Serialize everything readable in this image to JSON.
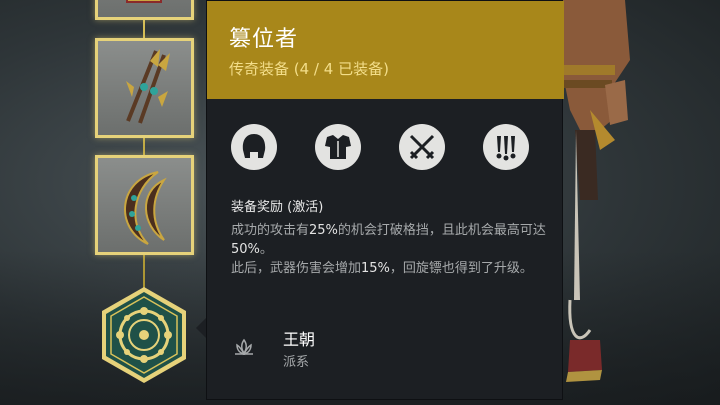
{
  "tooltip": {
    "title": "篡位者",
    "subtitle": "传奇装备 (4 / 4 已装备)",
    "icons": [
      "helmet-icon",
      "chest-armor-icon",
      "crossed-swords-icon",
      "throwing-knives-icon"
    ],
    "bonus_title": "装备奖励 (激活)",
    "bonus_desc": {
      "p1_a": "成功的攻击有",
      "p1_b": "25%",
      "p1_c": "的机会打破格挡，且此机会最高可达",
      "p1_d": "50%",
      "p1_e": "。",
      "p2_a": "此后，武器伤害会增加",
      "p2_b": "15%",
      "p2_c": "，回旋镖也得到了升级。"
    },
    "faction_title": "王朝",
    "faction_sub": "派系"
  },
  "equipment": {
    "slots": [
      "armor-piece",
      "glaive-weapon",
      "chakram-boomerang",
      "dynasty-faction-emblem"
    ]
  },
  "colors": {
    "header_gold": "#a8871a",
    "subtitle_gold": "#f3de8a",
    "panel_bg": "#1c1f23",
    "slot_border": "#e6d27a",
    "emblem_green": "#1f5148"
  }
}
